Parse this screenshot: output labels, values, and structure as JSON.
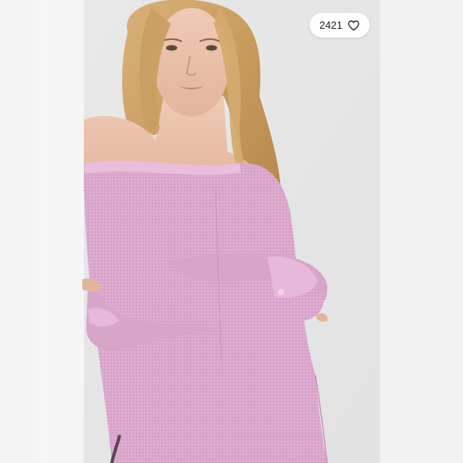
{
  "listing": {
    "like_count": "2421",
    "like_icon": "heart-outline-icon"
  },
  "colors": {
    "page_background": "#ffffff",
    "pill_background": "#ffffff",
    "pill_text": "#222222",
    "sweater": "#dba8cf"
  }
}
